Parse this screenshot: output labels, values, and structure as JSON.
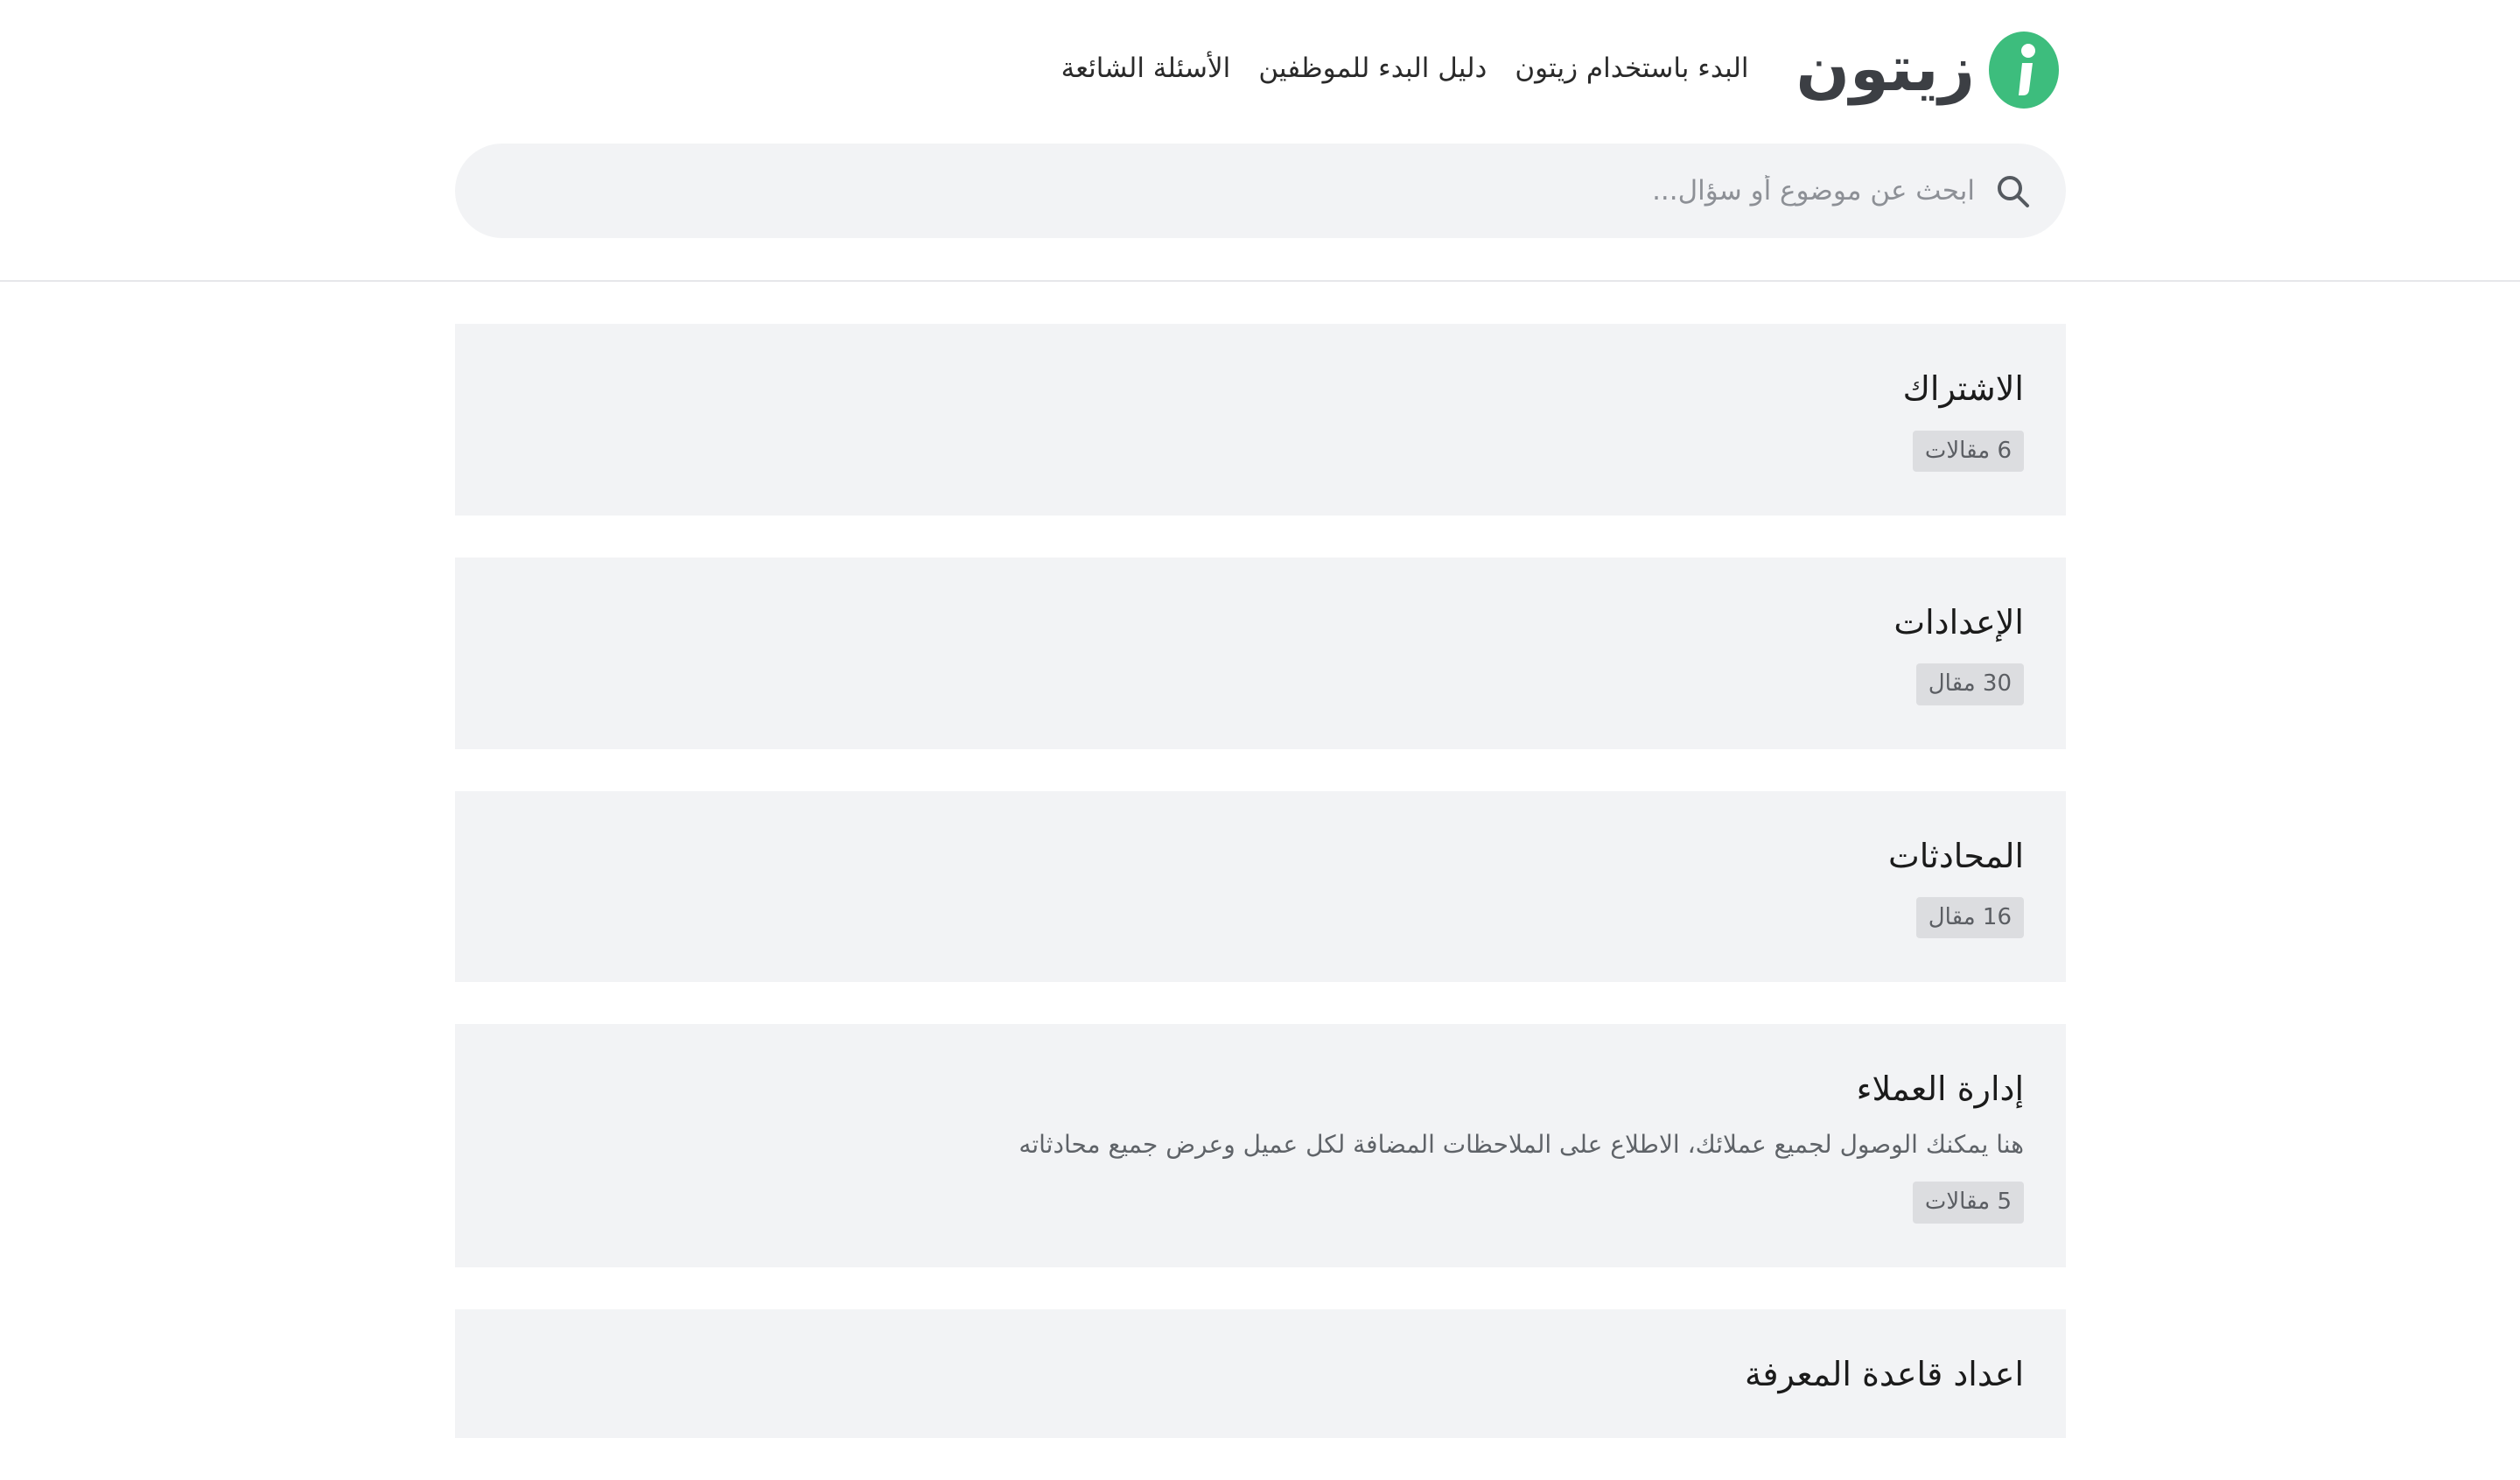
{
  "brand": {
    "name": "زيتون",
    "logo_icon": "zaytoon-logo-icon",
    "accent_color": "#3dbd7d"
  },
  "nav": {
    "links": [
      "البدء باستخدام زيتون",
      "دليل البدء للموظفين",
      "الأسئلة الشائعة"
    ]
  },
  "search": {
    "placeholder": "ابحث عن موضوع أو سؤال...",
    "value": "",
    "icon": "search-icon"
  },
  "categories": [
    {
      "title": "الاشتراك",
      "description": "",
      "count_label": "6 مقالات"
    },
    {
      "title": "الإعدادات",
      "description": "",
      "count_label": "30 مقال"
    },
    {
      "title": "المحادثات",
      "description": "",
      "count_label": "16 مقال"
    },
    {
      "title": "إدارة العملاء",
      "description": "هنا يمكنك الوصول لجميع عملائك، الاطلاع على الملاحظات المضافة لكل عميل وعرض جميع محادثاته",
      "count_label": "5 مقالات"
    },
    {
      "title": "اعداد قاعدة المعرفة",
      "description": "",
      "count_label": ""
    }
  ]
}
